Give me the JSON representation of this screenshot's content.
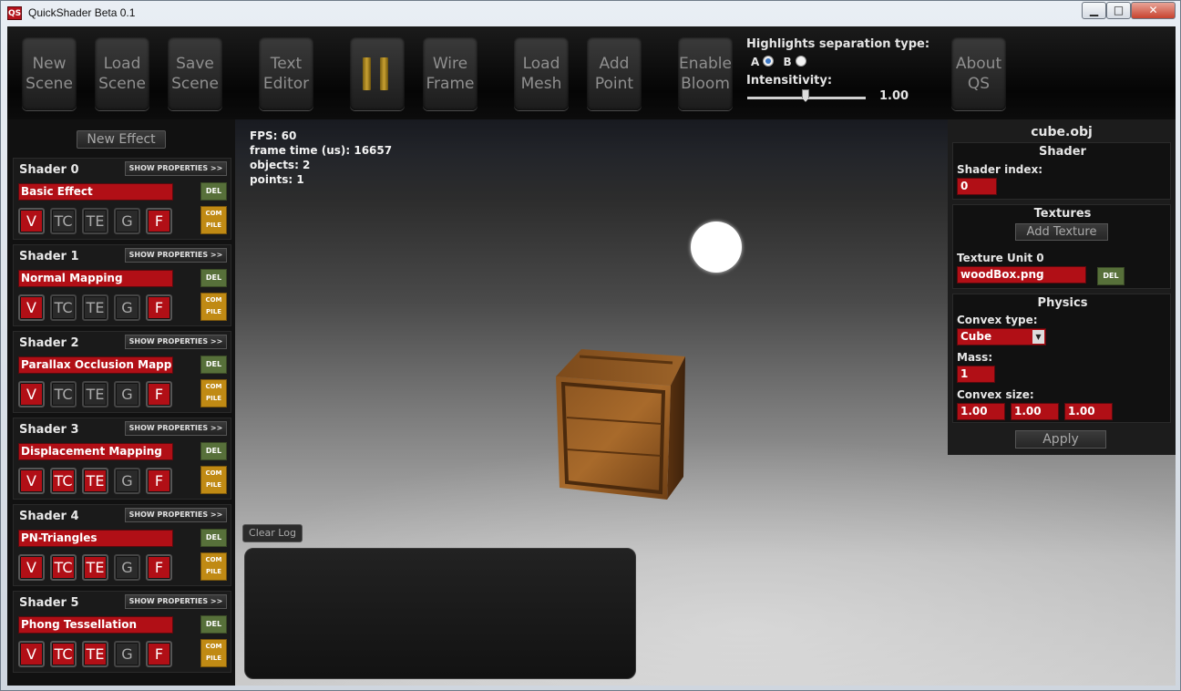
{
  "window": {
    "title": "QuickShader Beta 0.1",
    "icon_text": "QS",
    "controls": {
      "minimize": "▁",
      "maximize": "□",
      "close": "✕"
    }
  },
  "toolbar": {
    "buttons": [
      {
        "label": "New\nScene"
      },
      {
        "label": "Load\nScene"
      },
      {
        "label": "Save\nScene"
      },
      {
        "label": "Text\nEditor"
      },
      {
        "label": ""
      },
      {
        "label": "Wire\nFrame"
      },
      {
        "label": "Load\nMesh"
      },
      {
        "label": "Add\nPoint"
      },
      {
        "label": "Enable\nBloom"
      },
      {
        "label": "About\nQS"
      }
    ],
    "highlights": {
      "title": "Highlights separation type:",
      "option_a": "A",
      "option_b": "B",
      "selected": "A"
    },
    "intensivity": {
      "label": "Intensitivity:",
      "value": "1.00"
    }
  },
  "effects_panel": {
    "new_effect": "New Effect",
    "show_properties": "SHOW PROPERTIES >>",
    "del": "DEL",
    "compile_line1": "COM",
    "compile_line2": "PILE",
    "stage_labels": [
      "V",
      "TC",
      "TE",
      "G",
      "F"
    ],
    "shaders": [
      {
        "name": "Shader 0",
        "effect": "Basic Effect",
        "stages_on": [
          true,
          false,
          false,
          false,
          true
        ]
      },
      {
        "name": "Shader 1",
        "effect": "Normal Mapping",
        "stages_on": [
          true,
          false,
          false,
          false,
          true
        ]
      },
      {
        "name": "Shader 2",
        "effect": "Parallax Occlusion Mappi",
        "stages_on": [
          true,
          false,
          false,
          false,
          true
        ]
      },
      {
        "name": "Shader 3",
        "effect": "Displacement Mapping",
        "stages_on": [
          true,
          true,
          true,
          false,
          true
        ]
      },
      {
        "name": "Shader 4",
        "effect": "PN-Triangles",
        "stages_on": [
          true,
          true,
          true,
          false,
          true
        ]
      },
      {
        "name": "Shader 5",
        "effect": "Phong Tessellation",
        "stages_on": [
          true,
          true,
          true,
          false,
          true
        ]
      }
    ]
  },
  "viewport": {
    "stats": {
      "fps": "FPS: 60",
      "frame_time": "frame time (us): 16657",
      "objects": "objects: 2",
      "points": "points: 1"
    },
    "clear_log": "Clear Log"
  },
  "properties": {
    "object_name": "cube.obj",
    "shader": {
      "title": "Shader",
      "index_label": "Shader index:",
      "index_value": "0"
    },
    "textures": {
      "title": "Textures",
      "add_texture": "Add Texture",
      "unit_label": "Texture Unit 0",
      "unit_file": "woodBox.png",
      "del": "DEL"
    },
    "physics": {
      "title": "Physics",
      "convex_type_label": "Convex type:",
      "convex_type_value": "Cube",
      "mass_label": "Mass:",
      "mass_value": "1",
      "convex_size_label": "Convex size:",
      "convex_size": [
        "1.00",
        "1.00",
        "1.00"
      ]
    },
    "apply": "Apply"
  },
  "colors": {
    "accent_red": "#b10f16",
    "del_green": "#57703a",
    "compile_amber": "#c08a14"
  }
}
